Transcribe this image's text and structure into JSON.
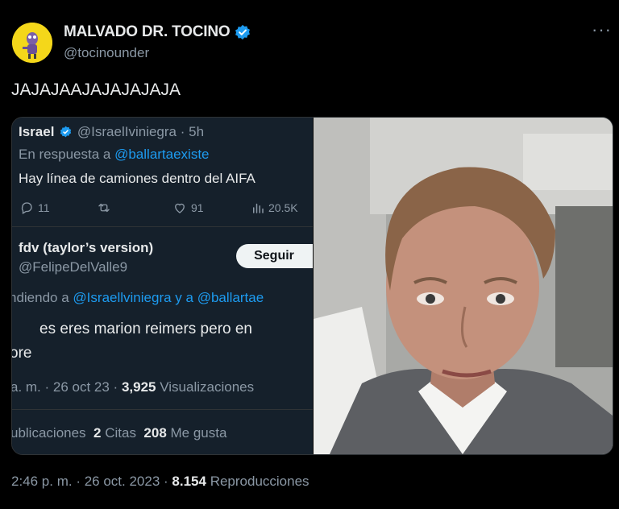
{
  "author": {
    "display_name": "MALVADO DR. TOCINO",
    "handle": "@tocinounder",
    "avatar_icon": "yellow-cartoon-avatar",
    "verified_icon": "verified-badge-icon",
    "more_icon": "more-options-icon",
    "more_label": "···"
  },
  "tweet": {
    "text": "JAJAJAAJAJAJAJAJA"
  },
  "quoted_screenshot": {
    "top_tweet": {
      "name": "Israel",
      "handle": "@IsraelIviniegra",
      "dot_time": "· 5h",
      "reply_prefix": "En respuesta a",
      "reply_target": "@ballartaexiste",
      "text": "Hay línea de camiones dentro del AIFA",
      "replies": "11",
      "likes": "91",
      "views": "20.5K"
    },
    "reply_tweet": {
      "name": "fdv (taylor’s version)",
      "handle": "@FelipeDelValle9",
      "follow_label": "Seguir",
      "reply_prefix": "ndiendo a",
      "reply_target_1": "@Israellviniegra",
      "reply_mid": "y a",
      "reply_target_2": "@ballartae",
      "text_line1": "es eres marion reimers pero en",
      "text_line2": "ore",
      "time_prefix": "a. m. · 26 oct 23 ·",
      "views_count": "3,925",
      "views_label": "Visualizaciones",
      "reposts_label": "ublicaciones",
      "quotes_count": "2",
      "quotes_label": "Citas",
      "likes_count": "208",
      "likes_label": "Me gusta"
    }
  },
  "footer": {
    "timestamp": "2:46 p. m. · 26 oct. 2023 ·",
    "views_count": "8.154",
    "views_label": "Reproducciones"
  },
  "colors": {
    "background": "#000000",
    "text": "#e7e9ea",
    "muted": "#8b98a5",
    "link": "#1d9bf0",
    "verified": "#1d9bf0",
    "avatar": "#f4d71a"
  }
}
